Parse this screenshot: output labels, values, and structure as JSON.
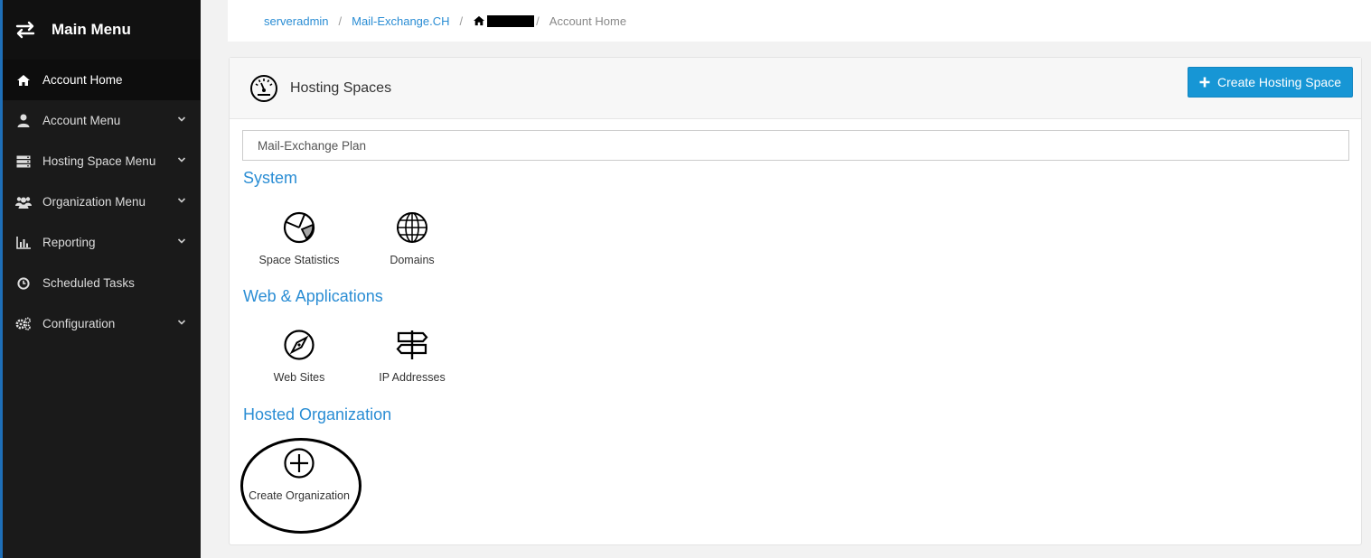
{
  "sidebar": {
    "title": "Main Menu",
    "items": [
      {
        "label": "Account Home",
        "icon": "home-icon",
        "active": true
      },
      {
        "label": "Account Menu",
        "icon": "user-icon",
        "expandable": true
      },
      {
        "label": "Hosting Space Menu",
        "icon": "server-icon",
        "expandable": true
      },
      {
        "label": "Organization Menu",
        "icon": "users-icon",
        "expandable": true
      },
      {
        "label": "Reporting",
        "icon": "bar-chart-icon",
        "expandable": true
      },
      {
        "label": "Scheduled Tasks",
        "icon": "clock-icon",
        "expandable": false
      },
      {
        "label": "Configuration",
        "icon": "cogs-icon",
        "expandable": true
      }
    ]
  },
  "breadcrumb": {
    "items": [
      "serveradmin",
      "Mail-Exchange.CH"
    ],
    "current": "Account Home"
  },
  "panel": {
    "title": "Hosting Spaces",
    "create_button": "Create Hosting Space",
    "plan": "Mail-Exchange Plan"
  },
  "sections": [
    {
      "title": "System",
      "tiles": [
        {
          "label": "Space Statistics",
          "icon": "pie-chart-icon"
        },
        {
          "label": "Domains",
          "icon": "globe-icon"
        }
      ]
    },
    {
      "title": "Web & Applications",
      "tiles": [
        {
          "label": "Web Sites",
          "icon": "compass-icon"
        },
        {
          "label": "IP Addresses",
          "icon": "signpost-icon"
        }
      ]
    },
    {
      "title": "Hosted Organization",
      "tiles": [
        {
          "label": "Create Organization",
          "icon": "plus-circle-icon"
        }
      ]
    }
  ],
  "colors": {
    "sidebar_bg": "#1a1a1a",
    "accent": "#2a8dd4",
    "button": "#1796d5"
  }
}
